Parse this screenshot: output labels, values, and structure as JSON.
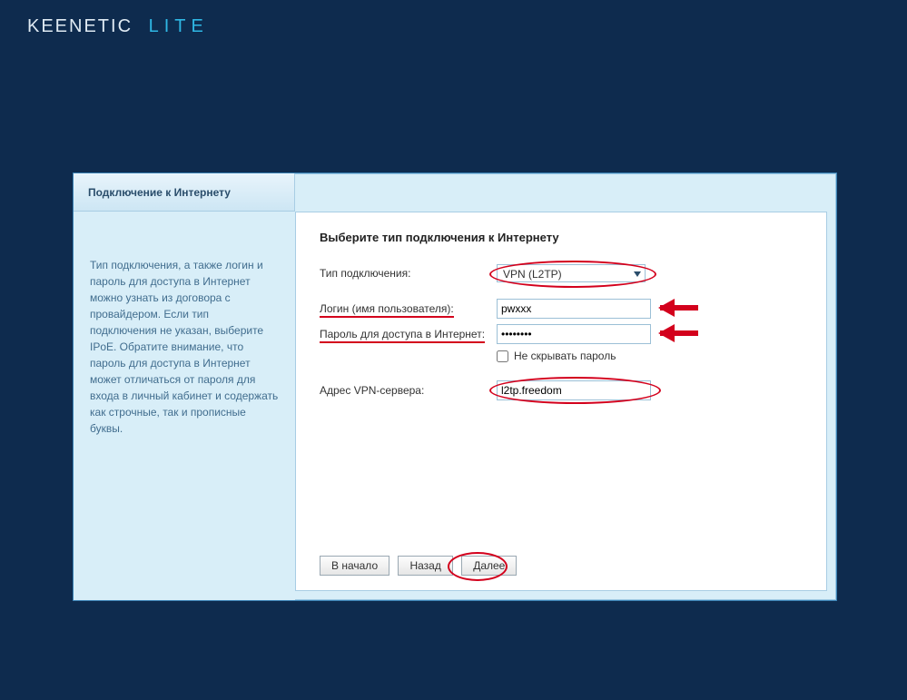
{
  "brand": {
    "name": "KEENETIC",
    "suffix": "LITE"
  },
  "sidebar": {
    "tab": "Подключение к Интернету",
    "help": "Тип подключения, а также логин и пароль для доступа в Интернет можно узнать из договора с провайдером. Если тип подключения не указан, выберите IPoE. Обратите внимание, что пароль для доступа в Интернет может отличаться от пароля для входа в личный кабинет и содержать как строчные, так и прописные буквы."
  },
  "form": {
    "heading": "Выберите тип подключения к Интернету",
    "conn_type_label": "Тип подключения:",
    "conn_type_value": "VPN (L2TP)",
    "login_label": "Логин (имя пользователя):",
    "login_value": "pwxxx",
    "password_label": "Пароль для доступа в Интернет:",
    "password_value": "********",
    "show_password_label": "Не скрывать пароль",
    "vpn_label": "Адрес VPN-сервера:",
    "vpn_value": "l2tp.freedom"
  },
  "buttons": {
    "start": "В начало",
    "back": "Назад",
    "next": "Далее"
  }
}
